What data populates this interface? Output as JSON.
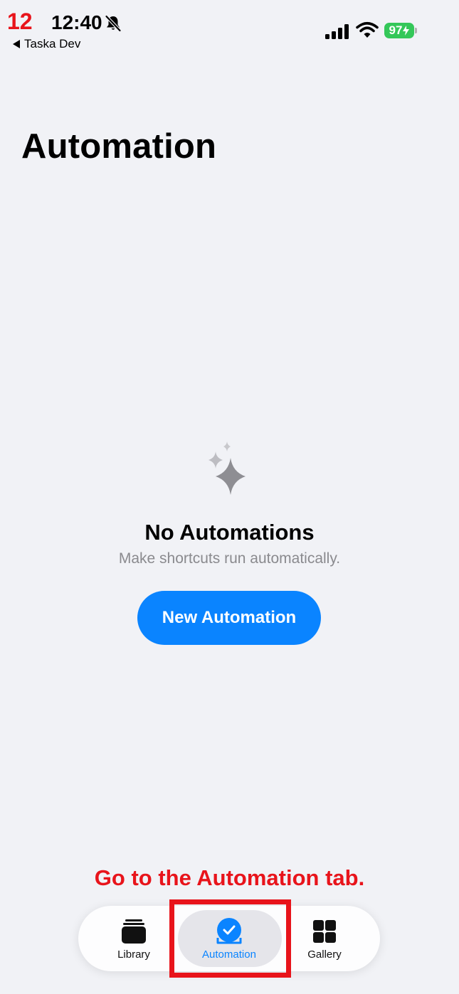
{
  "overlay": {
    "step_number": "12",
    "instruction": "Go to the Automation tab.",
    "highlight_color": "#E8141B"
  },
  "status_bar": {
    "time": "12:40",
    "back_app": "Taska Dev",
    "battery": "97",
    "icons": [
      "bell-slash-icon",
      "signal-icon",
      "wifi-icon",
      "battery-icon"
    ]
  },
  "page": {
    "title": "Automation"
  },
  "empty_state": {
    "icon": "sparkles-icon",
    "title": "No Automations",
    "subtitle": "Make shortcuts run automatically.",
    "button_label": "New Automation"
  },
  "tab_bar": {
    "tabs": [
      {
        "label": "Library",
        "icon": "library-stack-icon",
        "active": false
      },
      {
        "label": "Automation",
        "icon": "automation-check-icon",
        "active": true
      },
      {
        "label": "Gallery",
        "icon": "gallery-grid-icon",
        "active": false
      }
    ]
  },
  "colors": {
    "background": "#F1F2F6",
    "accent": "#0A84FF",
    "battery": "#34C759"
  }
}
